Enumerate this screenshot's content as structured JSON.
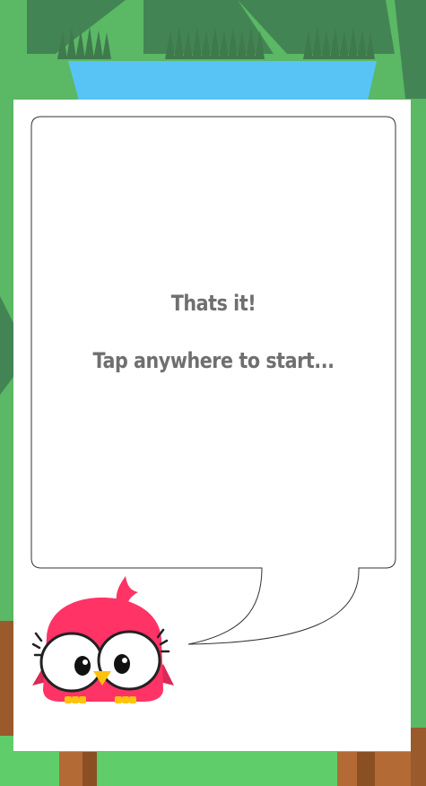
{
  "dialog": {
    "title": "Thats it!",
    "hint": "Tap anywhere to start..."
  },
  "mascot": {
    "icon": "pink-bird-icon"
  },
  "colors": {
    "sky_grass": "#5bb865",
    "dark_grass": "#438454",
    "water": "#58c4f6",
    "panel": "#ffffff",
    "text": "#6f6f6f",
    "bird_body": "#ff3366",
    "wood": "#b36a35"
  }
}
